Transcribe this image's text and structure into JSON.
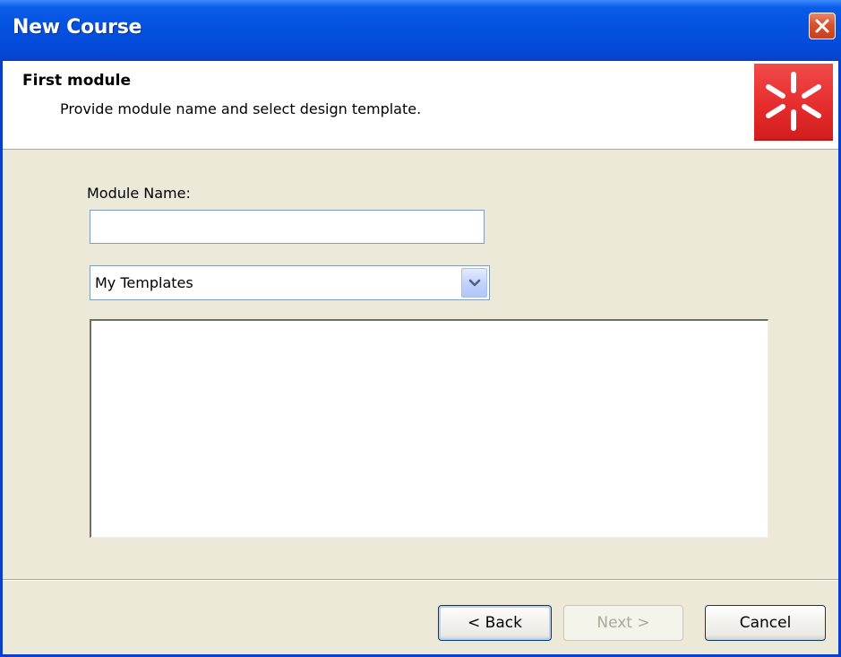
{
  "window": {
    "title": "New Course"
  },
  "header": {
    "title": "First module",
    "subtitle": "Provide module name and select design template."
  },
  "form": {
    "module_name_label": "Module Name:",
    "module_name_value": "",
    "template_category_selected": "My Templates"
  },
  "buttons": {
    "back": "< Back",
    "next": "Next >",
    "cancel": "Cancel",
    "next_enabled": false
  },
  "colors": {
    "titlebar": "#0553E1",
    "logo": "#E52B2B",
    "dialog_background": "#ECE9D8"
  },
  "icons": {
    "close": "close-icon",
    "logo": "asterisk-logo-icon",
    "dropdown": "chevron-down-icon"
  }
}
